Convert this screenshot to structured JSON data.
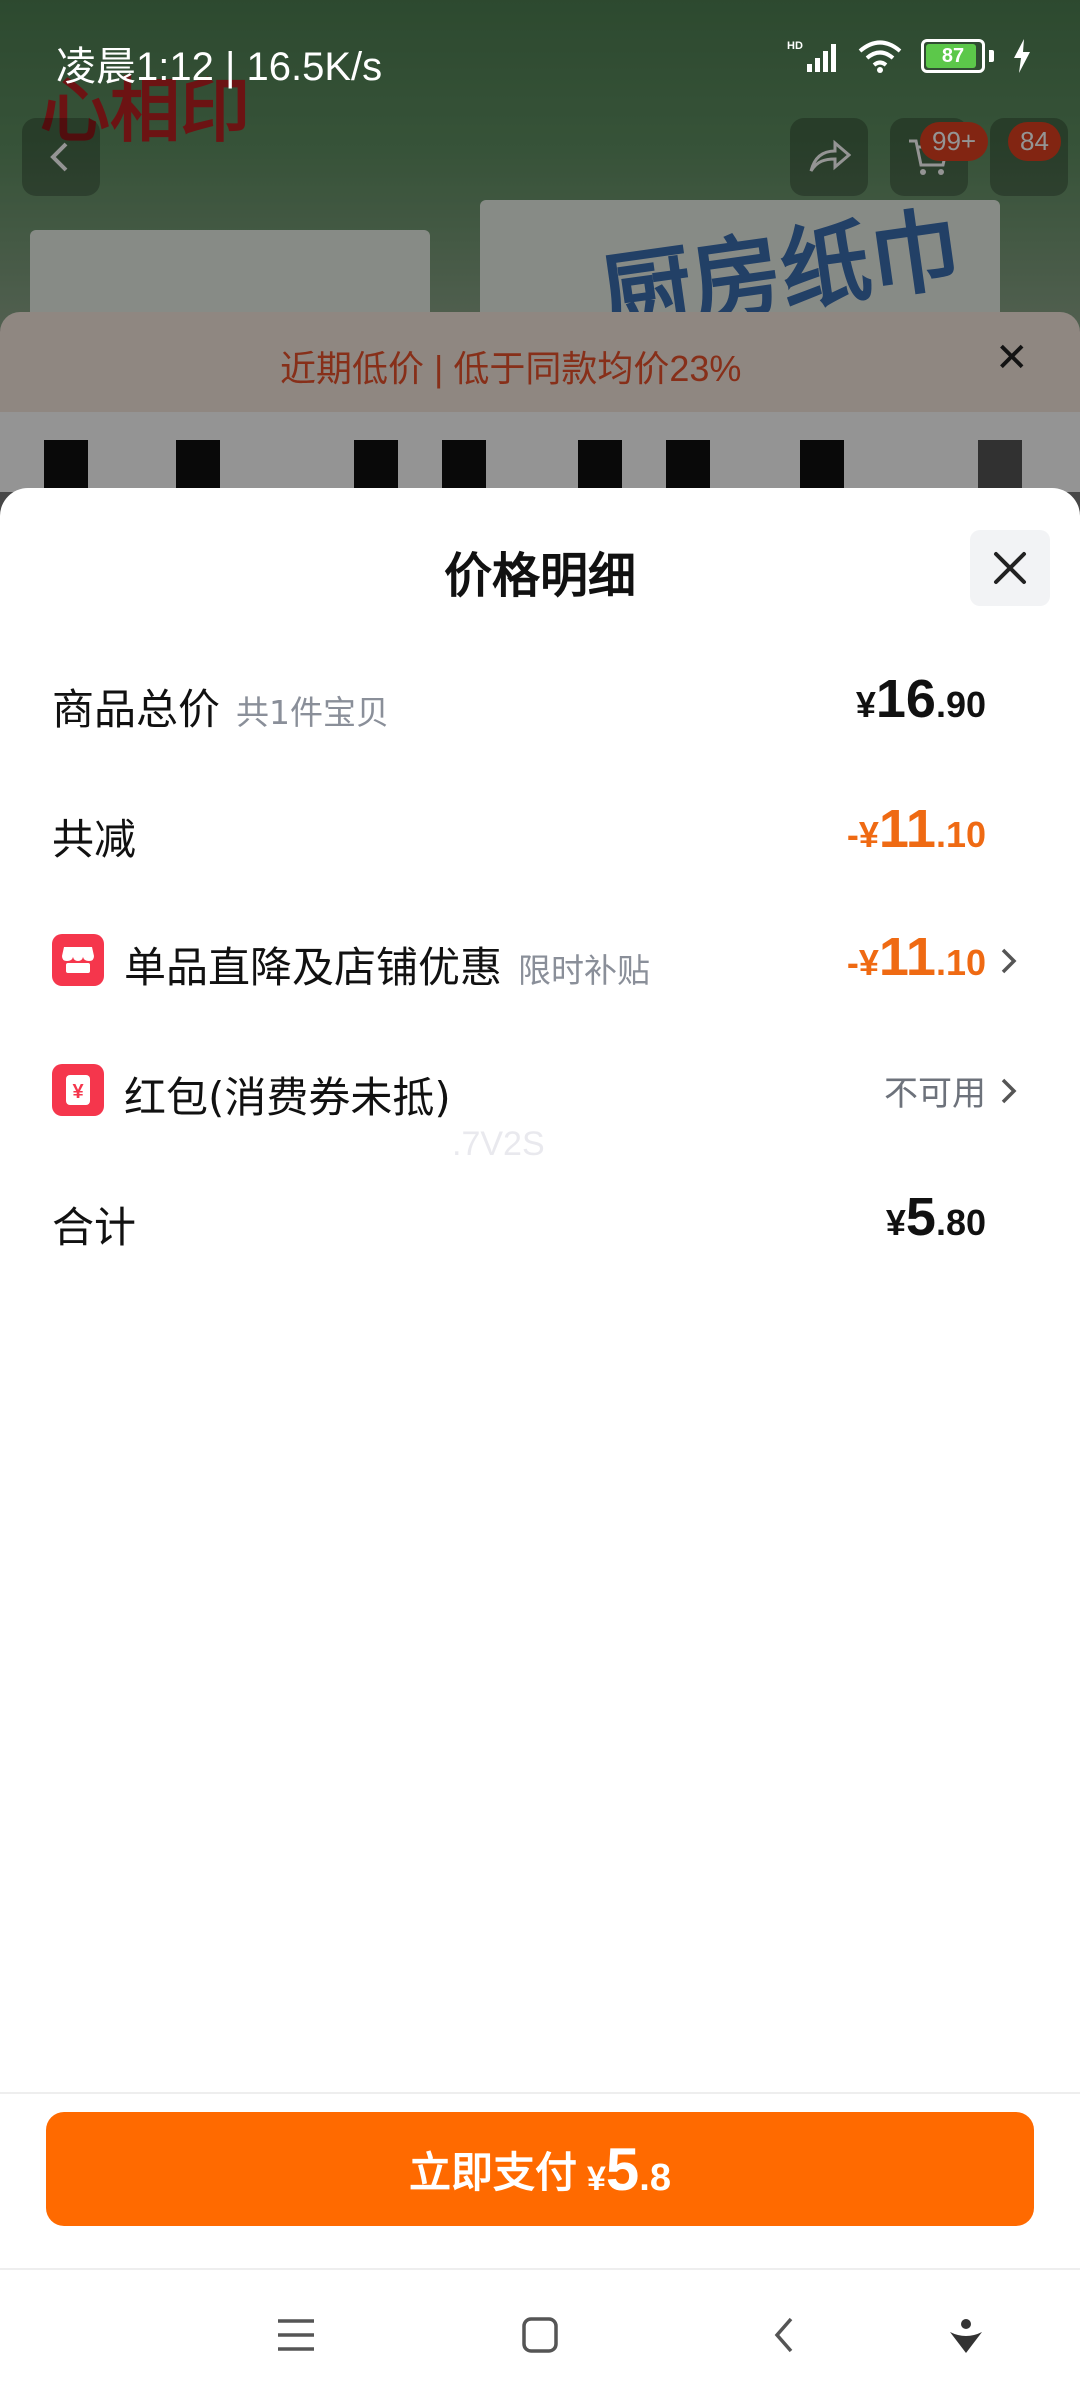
{
  "status_bar": {
    "time_speed": "凌晨1:12 | 16.5K/s",
    "battery": "87"
  },
  "background": {
    "brand_logo": "心相印",
    "banner_text": "厨房纸巾",
    "cart_badge": "99+",
    "msg_badge": "84",
    "price_hint": "近期低价 | 低于同款均价23%"
  },
  "sheet": {
    "title": "价格明细",
    "rows": {
      "total": {
        "label": "商品总价",
        "sub": "共1件宝贝",
        "price": {
          "cur": "¥",
          "int": "16",
          "dec": ".90"
        }
      },
      "reduction": {
        "label": "共减",
        "price": {
          "cur": "-¥",
          "int": "11",
          "dec": ".10"
        }
      },
      "discount": {
        "label": "单品直降及店铺优惠",
        "sub": "限时补贴",
        "price": {
          "cur": "-¥",
          "int": "11",
          "dec": ".10"
        }
      },
      "redpacket": {
        "label": "红包(消费券未抵)",
        "status": "不可用"
      },
      "sum": {
        "label": "合计",
        "price": {
          "cur": "¥",
          "int": "5",
          "dec": ".80"
        }
      }
    },
    "watermark": ".7V2S"
  },
  "pay": {
    "label": "立即支付",
    "cur": "¥",
    "int": "5",
    "dec": ".8"
  },
  "colors": {
    "accent": "#ff6a00",
    "discount": "#ef6a13",
    "icon_red": "#f5364c"
  }
}
